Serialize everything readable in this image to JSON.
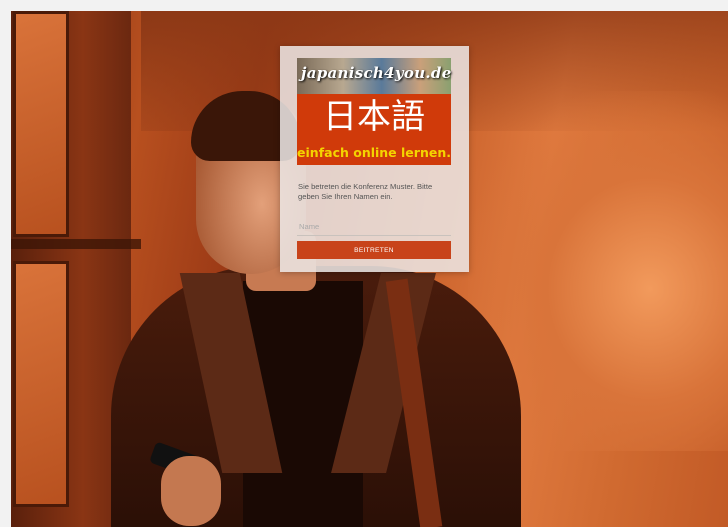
{
  "background": {
    "description_icon": "person-with-phone-photo",
    "tint_color": "#c8562a"
  },
  "card": {
    "logo": {
      "site_text": "japanisch4you.de",
      "japanese_text": "日本語",
      "tagline": "einfach online lernen.",
      "brand_color": "#d03a0a",
      "tagline_color": "#f4d400"
    },
    "message": "Sie betreten die Konferenz Muster. Bitte geben Sie Ihren Namen ein.",
    "name_input": {
      "value": "",
      "placeholder": "Name"
    },
    "join_button_label": "BEITRETEN",
    "accent_color": "#c8431a"
  }
}
